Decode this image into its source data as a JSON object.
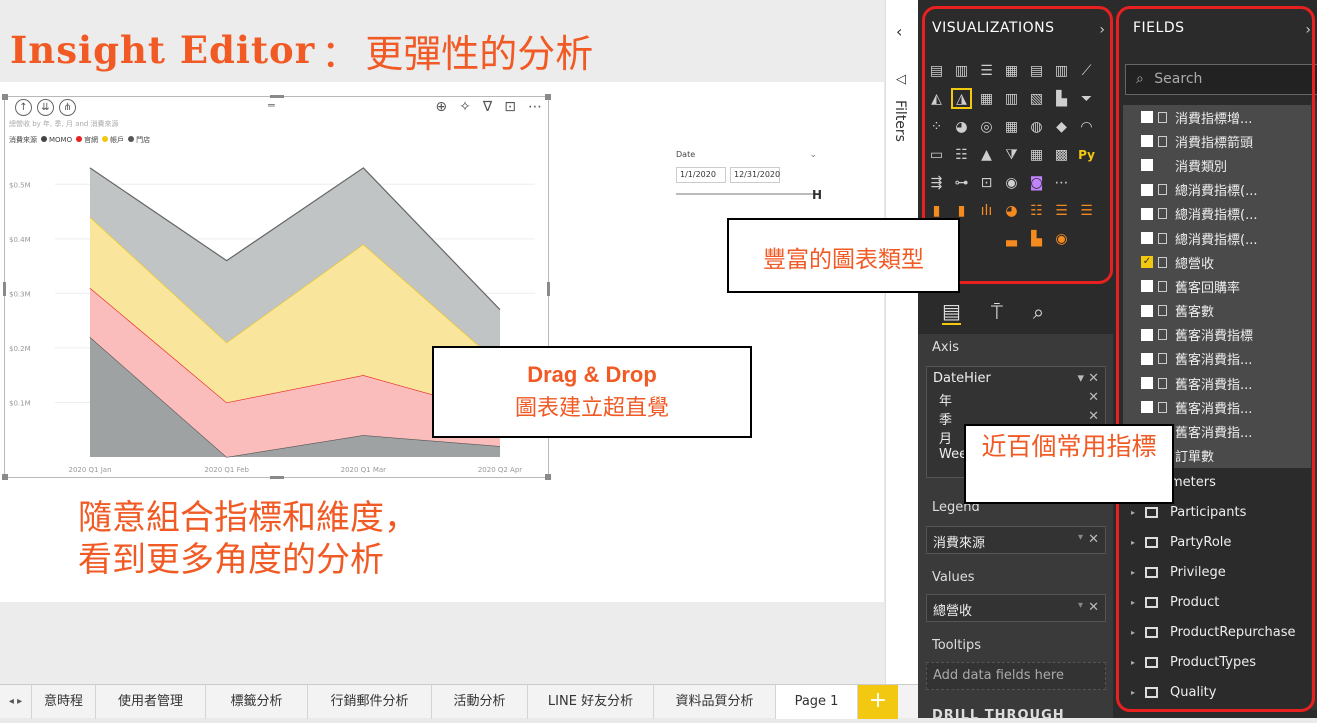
{
  "header": {
    "title_en": "Insight Editor",
    "title_sep": "：",
    "title_zh": "更彈性的分析"
  },
  "visual": {
    "header_icons": [
      "up-arrow-icon",
      "double-down-icon",
      "expand-hierarchy-icon"
    ],
    "title": "總營收 by 年, 季, 月 and 消費來源",
    "legend_title": "消費來源",
    "legend": [
      {
        "label": "MOMO",
        "color": "#444444"
      },
      {
        "label": "官網",
        "color": "#e8201f"
      },
      {
        "label": "帳戶",
        "color": "#f2c811"
      },
      {
        "label": "門店",
        "color": "#555555"
      }
    ]
  },
  "chart_data": {
    "type": "area",
    "stacked": true,
    "categories": [
      "2020 Q1 Jan",
      "2020 Q1 Feb",
      "2020 Q1 Mar",
      "2020 Q2 Apr"
    ],
    "yticks": [
      "$0.1M",
      "$0.2M",
      "$0.3M",
      "$0.4M",
      "$0.5M"
    ],
    "ylim": [
      0,
      0.55
    ],
    "series": [
      {
        "name": "MOMO",
        "color": "#9ea2a2",
        "values": [
          0.22,
          0.0,
          0.04,
          0.02
        ]
      },
      {
        "name": "官網",
        "color": "#fbbcbc",
        "values": [
          0.09,
          0.1,
          0.11,
          0.06
        ]
      },
      {
        "name": "帳戶",
        "color": "#fae59c",
        "values": [
          0.13,
          0.11,
          0.24,
          0.09
        ]
      },
      {
        "name": "門店",
        "color": "#c0c4c4",
        "values": [
          0.09,
          0.15,
          0.14,
          0.1
        ]
      }
    ],
    "grid": true
  },
  "slicer": {
    "label": "Date",
    "start": "1/1/2020",
    "end": "12/31/2020"
  },
  "callouts": {
    "chart_types": "豐富的圖表類型",
    "dnd_en": "Drag & Drop",
    "dnd_zh": "圖表建立超直覺",
    "metrics": "近百個常用指標"
  },
  "caption": {
    "line1": "隨意組合指標和維度，",
    "line2": "看到更多角度的分析"
  },
  "tabs": [
    "意時程",
    "使用者管理",
    "標籤分析",
    "行銷郵件分析",
    "活動分析",
    "LINE 好友分析",
    "資料品質分析",
    "Page 1"
  ],
  "filters": {
    "label": "Filters"
  },
  "viz_pane": {
    "title": "VISUALIZATIONS",
    "axis_label": "Axis",
    "axis_items": [
      "DateHier",
      "年",
      "季",
      "月",
      "Wee"
    ],
    "legend_label": "Legend",
    "legend_value": "消費來源",
    "values_label": "Values",
    "values_value": "總營收",
    "tooltips_label": "Tooltips",
    "tooltips_placeholder": "Add data fields here",
    "drill_label": "DRILL THROUGH"
  },
  "fields_pane": {
    "title": "FIELDS",
    "search_placeholder": "Search",
    "fields": [
      {
        "label": "消費指標增...",
        "checked": false,
        "table_icon": true
      },
      {
        "label": "消費指標箭頭",
        "checked": false,
        "table_icon": true
      },
      {
        "label": "消費類別",
        "checked": false,
        "table_icon": false
      },
      {
        "label": "總消費指標(...",
        "checked": false,
        "table_icon": true
      },
      {
        "label": "總消費指標(...",
        "checked": false,
        "table_icon": true
      },
      {
        "label": "總消費指標(...",
        "checked": false,
        "table_icon": true
      },
      {
        "label": "總營收",
        "checked": true,
        "table_icon": true
      },
      {
        "label": "舊客回購率",
        "checked": false,
        "table_icon": true
      },
      {
        "label": "舊客數",
        "checked": false,
        "table_icon": true
      },
      {
        "label": "舊客消費指標",
        "checked": false,
        "table_icon": true
      },
      {
        "label": "舊客消費指...",
        "checked": false,
        "table_icon": true
      },
      {
        "label": "舊客消費指...",
        "checked": false,
        "table_icon": true
      },
      {
        "label": "舊客消費指...",
        "checked": false,
        "table_icon": true
      },
      {
        "label": "舊客消費指...",
        "checked": false,
        "table_icon": true
      },
      {
        "label": "訂單數",
        "checked": false,
        "table_icon": true
      }
    ],
    "tables": [
      "meters",
      "Participants",
      "PartyRole",
      "Privilege",
      "Product",
      "ProductRepurchase",
      "ProductTypes",
      "Quality"
    ]
  }
}
